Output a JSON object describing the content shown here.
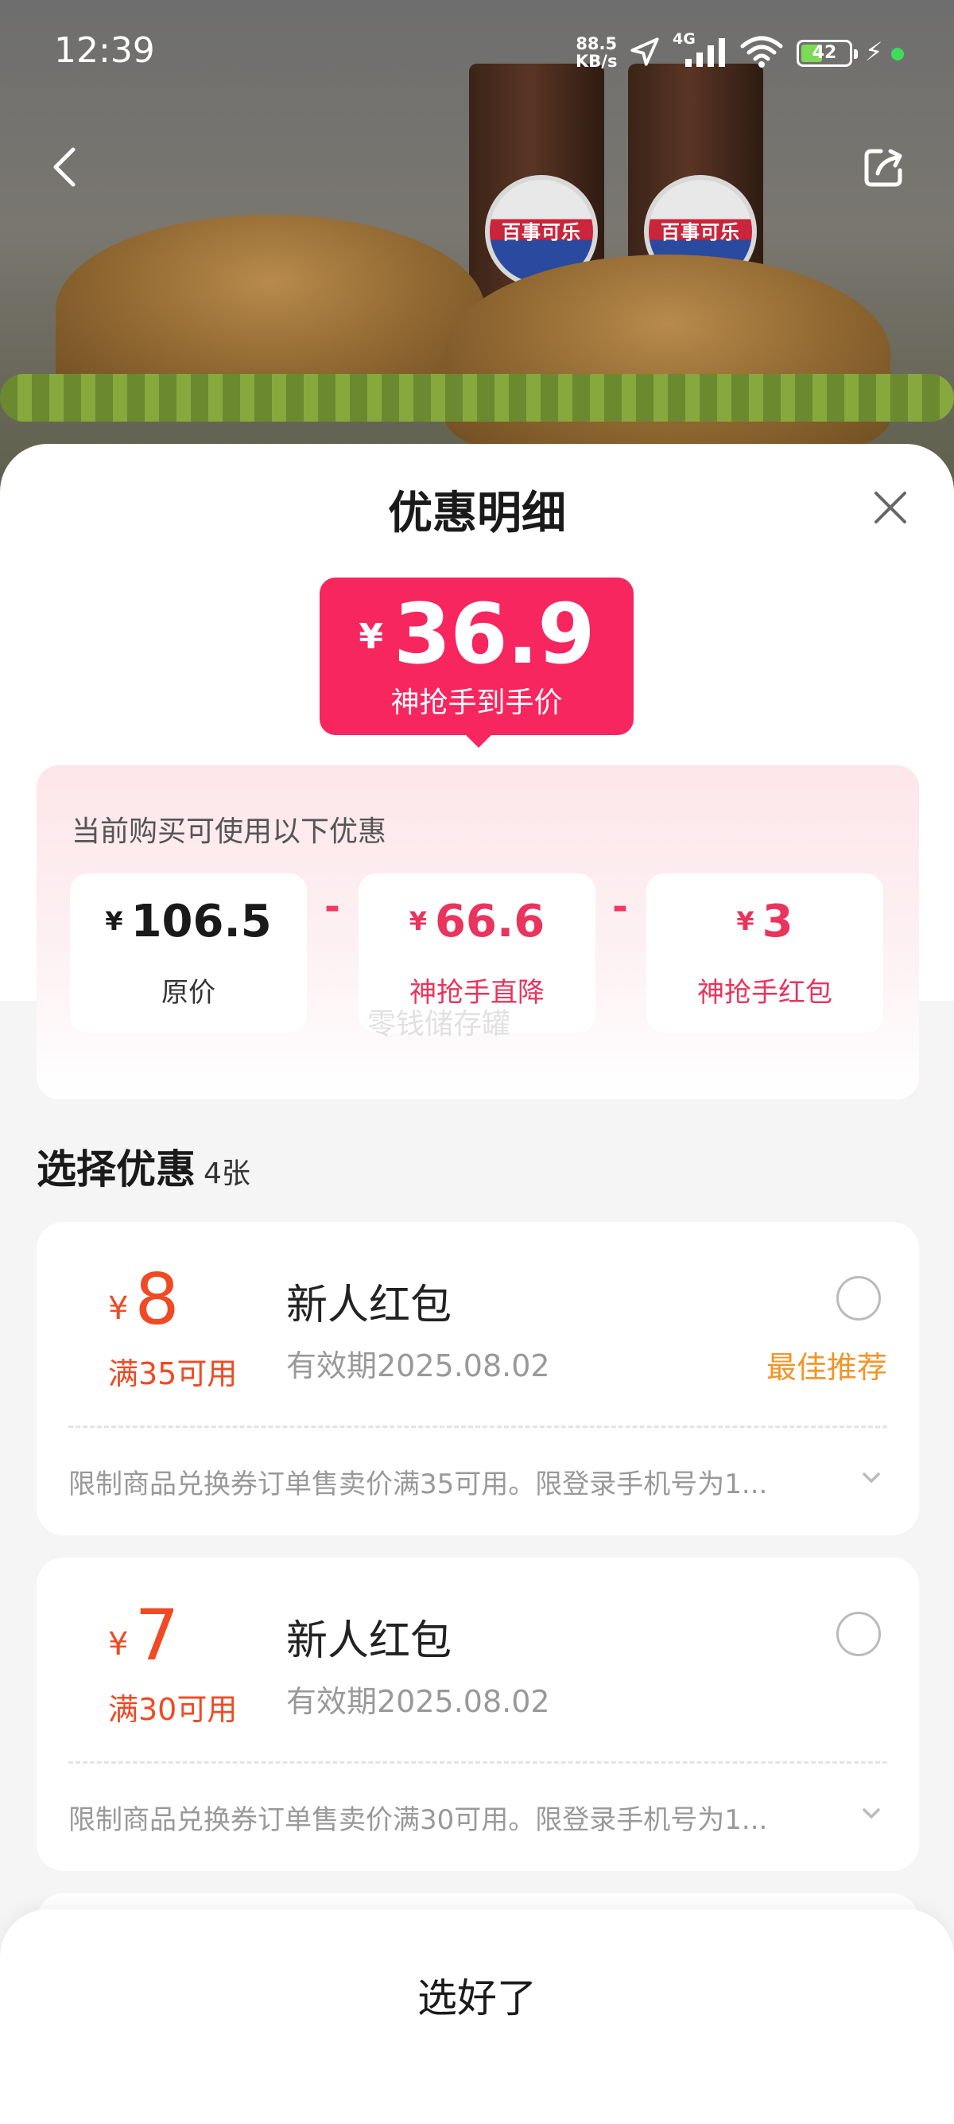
{
  "status_bar": {
    "time": "12:39",
    "net_speed_value": "88.5",
    "net_speed_unit": "KB/s",
    "network_type": "4G",
    "battery": "42"
  },
  "hero_image": {
    "cup_brand_text": "百事可乐"
  },
  "sheet": {
    "title": "优惠明细",
    "final_price": {
      "currency": "¥",
      "value": "36.9",
      "label": "神抢手到手价"
    },
    "breakdown": {
      "heading": "当前购买可使用以下优惠",
      "operator": "-",
      "items": [
        {
          "currency": "¥",
          "value": "106.5",
          "label": "原价"
        },
        {
          "currency": "¥",
          "value": "66.6",
          "label": "神抢手直降"
        },
        {
          "currency": "¥",
          "value": "3",
          "label": "神抢手红包"
        }
      ],
      "watermark": "零钱储存罐"
    },
    "select": {
      "title": "选择优惠",
      "count": "4张"
    },
    "coupons": [
      {
        "currency": "¥",
        "amount": "8",
        "condition": "满35可用",
        "name": "新人红包",
        "expiry": "有效期2025.08.02",
        "tag": "最佳推荐",
        "description": "限制商品兑换券订单售卖价满35可用。限登录手机号为1..."
      },
      {
        "currency": "¥",
        "amount": "7",
        "condition": "满30可用",
        "name": "新人红包",
        "expiry": "有效期2025.08.02",
        "tag": "",
        "description": "限制商品兑换券订单售卖价满30可用。限登录手机号为1..."
      }
    ],
    "confirm_label": "选好了"
  },
  "colors": {
    "accent_pink": "#f7265e",
    "coupon_orange": "#f04a24",
    "best_tag": "#f0962a"
  },
  "icons": [
    "back-icon",
    "share-icon",
    "close-icon",
    "radio-unchecked-icon",
    "chevron-down-icon",
    "location-arrow-icon",
    "signal-icon",
    "wifi-icon",
    "battery-icon",
    "charging-bolt-icon"
  ]
}
